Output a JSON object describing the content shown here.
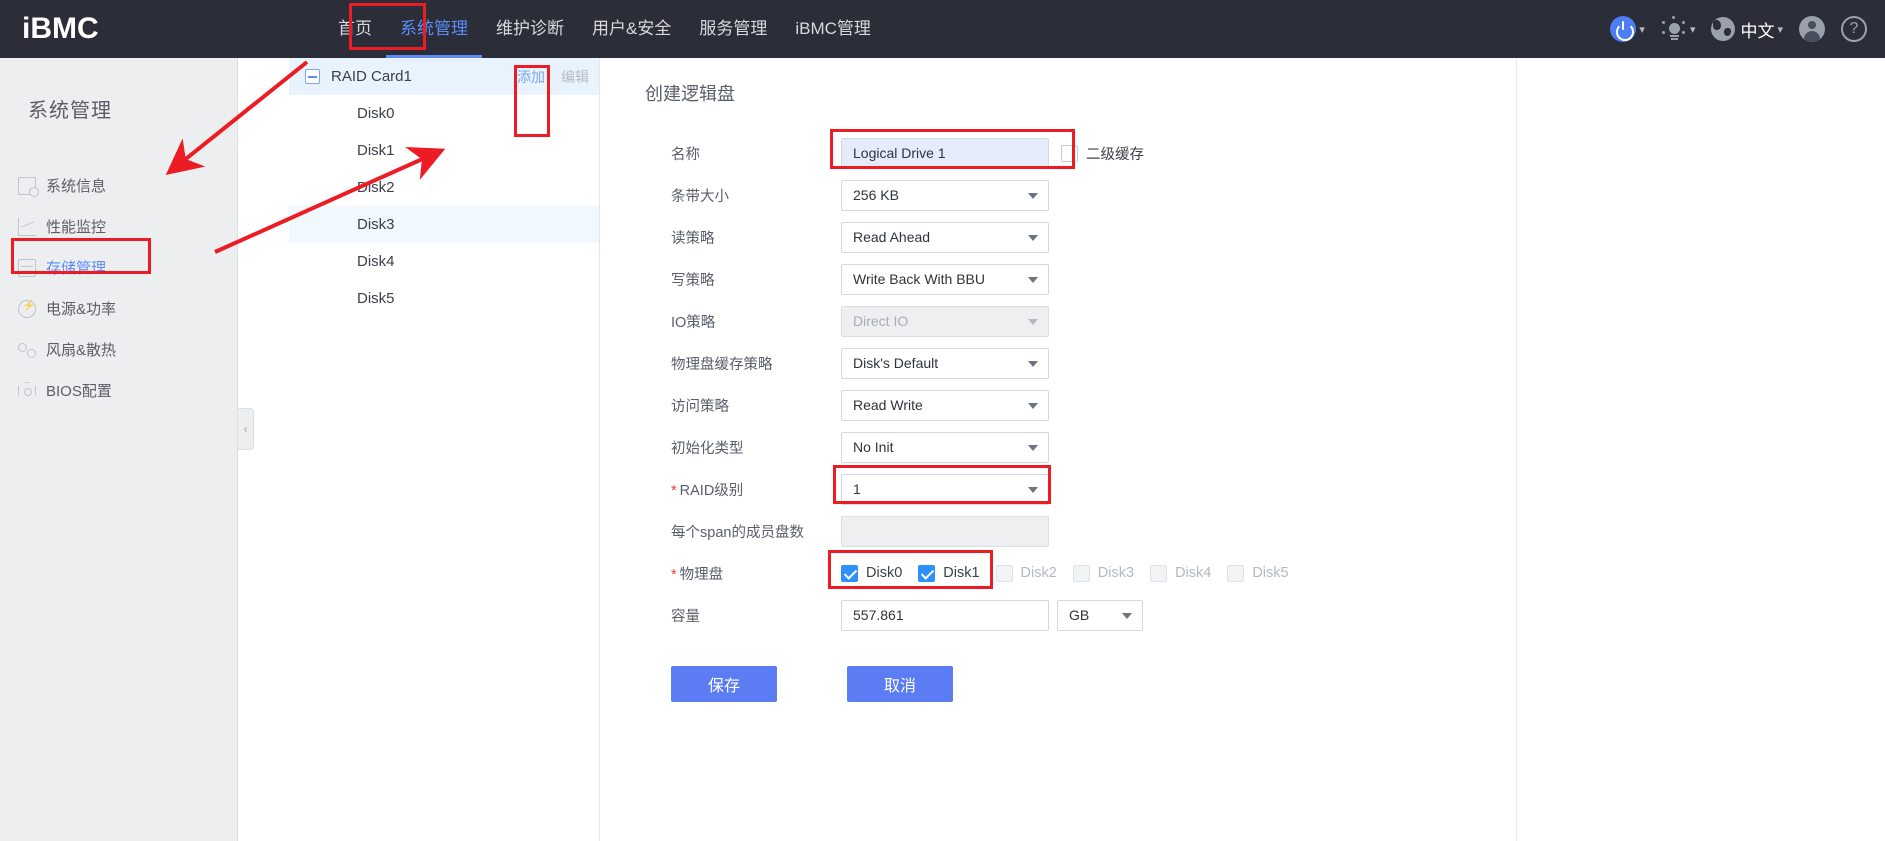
{
  "header": {
    "logo": "iBMC",
    "nav": [
      {
        "label": "首页",
        "active": false
      },
      {
        "label": "系统管理",
        "active": true
      },
      {
        "label": "维护诊断",
        "active": false
      },
      {
        "label": "用户&安全",
        "active": false
      },
      {
        "label": "服务管理",
        "active": false
      },
      {
        "label": "iBMC管理",
        "active": false
      }
    ],
    "icons": {
      "power": "power-icon",
      "brightness": "brightness-icon",
      "globe": "globe-icon",
      "language": "中文",
      "user": "user-avatar-icon",
      "help": "?"
    }
  },
  "sidebar": {
    "title": "系统管理",
    "items": [
      {
        "label": "系统信息",
        "icon": "document-settings-icon",
        "active": false
      },
      {
        "label": "性能监控",
        "icon": "line-chart-icon",
        "active": false
      },
      {
        "label": "存储管理",
        "icon": "storage-icon",
        "active": true
      },
      {
        "label": "电源&功率",
        "icon": "power-circle-icon",
        "active": false
      },
      {
        "label": "风扇&散热",
        "icon": "fan-icon",
        "active": false
      },
      {
        "label": "BIOS配置",
        "icon": "bios-hex-icon",
        "active": false
      }
    ]
  },
  "collapse_handle": "‹",
  "tree": {
    "root": {
      "label": "RAID Card1",
      "expanded": true
    },
    "actions": {
      "add": "添加",
      "edit": "编辑"
    },
    "children": [
      {
        "label": "Disk0",
        "selected": false
      },
      {
        "label": "Disk1",
        "selected": false
      },
      {
        "label": "Disk2",
        "selected": false
      },
      {
        "label": "Disk3",
        "selected": true
      },
      {
        "label": "Disk4",
        "selected": false
      },
      {
        "label": "Disk5",
        "selected": false
      }
    ]
  },
  "form": {
    "title": "创建逻辑盘",
    "fields": {
      "name": {
        "label": "名称",
        "value": "Logical Drive 1"
      },
      "secondary_cache": {
        "label": "二级缓存",
        "checked": false
      },
      "stripe_size": {
        "label": "条带大小",
        "value": "256 KB"
      },
      "read_policy": {
        "label": "读策略",
        "value": "Read Ahead"
      },
      "write_policy": {
        "label": "写策略",
        "value": "Write Back With BBU"
      },
      "io_policy": {
        "label": "IO策略",
        "value": "Direct IO",
        "disabled": true
      },
      "disk_cache_policy": {
        "label": "物理盘缓存策略",
        "value": "Disk's Default"
      },
      "access_policy": {
        "label": "访问策略",
        "value": "Read Write"
      },
      "init_type": {
        "label": "初始化类型",
        "value": "No Init"
      },
      "raid_level": {
        "label": "RAID级别",
        "value": "1",
        "required": true
      },
      "span_members": {
        "label": "每个span的成员盘数",
        "value": "",
        "disabled": true
      },
      "physical_disks": {
        "label": "物理盘",
        "required": true,
        "options": [
          {
            "label": "Disk0",
            "checked": true,
            "disabled": false
          },
          {
            "label": "Disk1",
            "checked": true,
            "disabled": false
          },
          {
            "label": "Disk2",
            "checked": false,
            "disabled": true
          },
          {
            "label": "Disk3",
            "checked": false,
            "disabled": true
          },
          {
            "label": "Disk4",
            "checked": false,
            "disabled": true
          },
          {
            "label": "Disk5",
            "checked": false,
            "disabled": true
          }
        ]
      },
      "capacity": {
        "label": "容量",
        "value": "557.861",
        "unit": "GB"
      }
    },
    "buttons": {
      "save": "保存",
      "cancel": "取消"
    }
  },
  "annotation_color": "#ed1c24"
}
